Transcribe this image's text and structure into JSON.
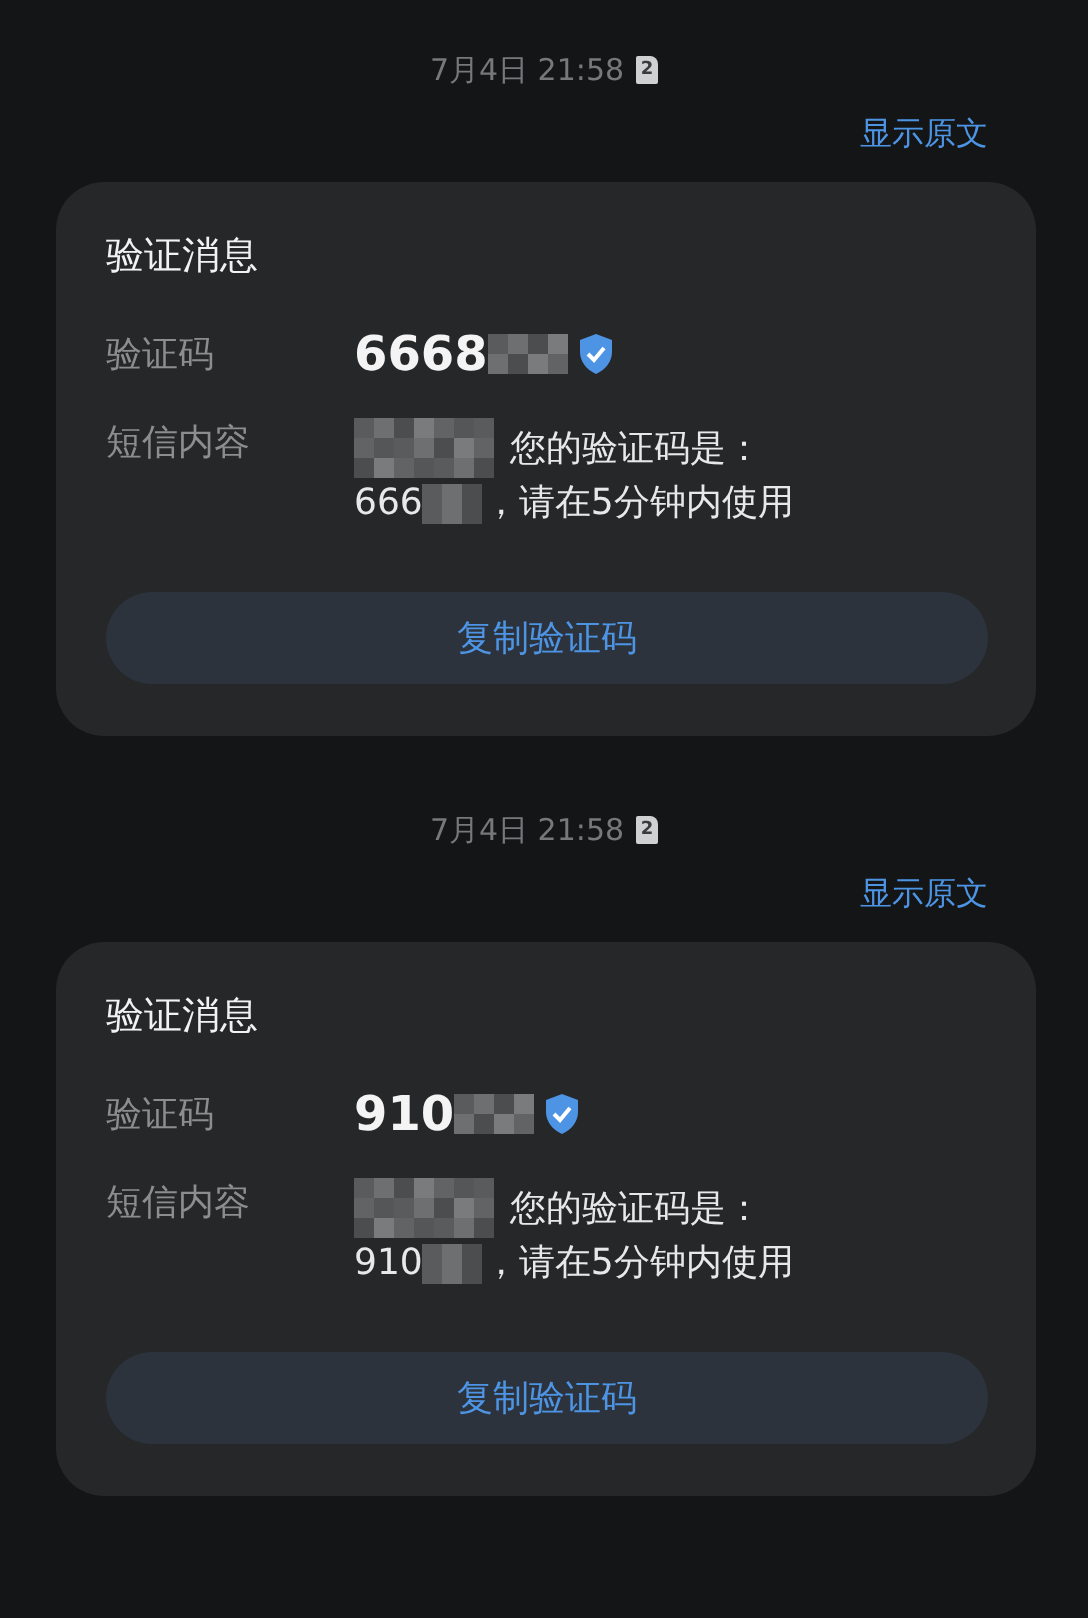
{
  "messages": [
    {
      "timestamp": "7月4日 21:58",
      "sim_slot": "2",
      "show_original": "显示原文",
      "card": {
        "title": "验证消息",
        "code_label": "验证码",
        "code": "6668",
        "code_redacted": true,
        "verified": true,
        "content_label": "短信内容",
        "sender_redacted": true,
        "content_line1": "您的验证码是：",
        "content_code": "666",
        "content_code_redacted": true,
        "content_rest": "，请在5分钟内使用",
        "copy_button": "复制验证码"
      }
    },
    {
      "timestamp": "7月4日 21:58",
      "sim_slot": "2",
      "show_original": "显示原文",
      "card": {
        "title": "验证消息",
        "code_label": "验证码",
        "code": "910",
        "code_redacted": true,
        "verified": true,
        "content_label": "短信内容",
        "sender_redacted": true,
        "content_line1": "您的验证码是：",
        "content_code": "910",
        "content_code_redacted": true,
        "content_rest": "，请在5分钟内使用",
        "copy_button": "复制验证码"
      }
    }
  ]
}
